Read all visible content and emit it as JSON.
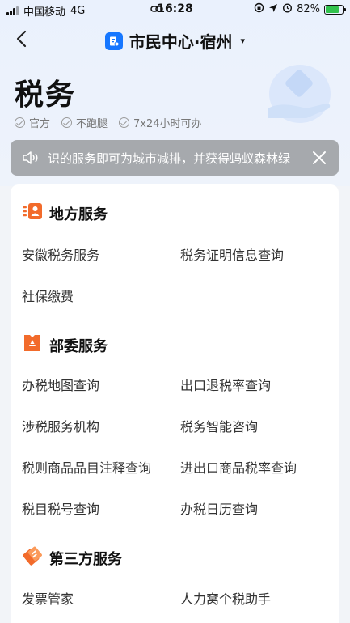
{
  "status_bar": {
    "carrier": "中国移动",
    "network": "4G",
    "time": "16:28",
    "battery": "82%",
    "battery_level": 0.82
  },
  "nav": {
    "title": "市民中心·宿州",
    "caret": "▾",
    "icons": {
      "back": "chevron-left-icon",
      "logo": "tax-doc-icon"
    }
  },
  "header": {
    "title": "税务",
    "tags": [
      "官方",
      "不跑腿",
      "7x24小时可办"
    ]
  },
  "notice": {
    "text": "识的服务即可为城市减排，并获得蚂蚁森林绿",
    "icons": {
      "speaker": "speaker-icon",
      "close": "close-icon"
    }
  },
  "sections": [
    {
      "title": "地方服务",
      "icon": "local-service-icon",
      "items": [
        "安徽税务服务",
        "税务证明信息查询",
        "社保缴费"
      ]
    },
    {
      "title": "部委服务",
      "icon": "ministry-service-icon",
      "items": [
        "办税地图查询",
        "出口退税率查询",
        "涉税服务机构",
        "税务智能咨询",
        "税则商品品目注释查询",
        "进出口商品税率查询",
        "税目税号查询",
        "办税日历查询"
      ]
    },
    {
      "title": "第三方服务",
      "icon": "third-party-service-icon",
      "items": [
        "发票管家",
        "人力窝个税助手"
      ]
    }
  ],
  "colors": {
    "accent": "#1677ff",
    "orange": "#f26b2b",
    "notice_bg": "#a6a9ad"
  }
}
